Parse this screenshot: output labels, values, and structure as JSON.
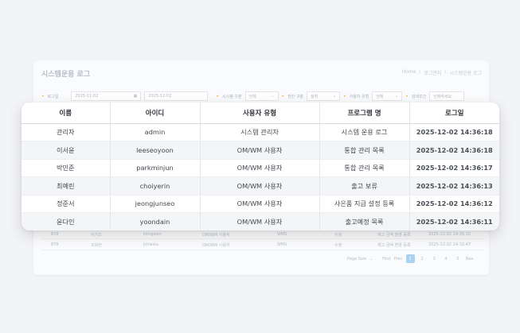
{
  "background": {
    "title": "시스템운용 로그",
    "breadcrumb": [
      "Home",
      "/",
      "로그관리",
      "/",
      "시스템운용 로그"
    ],
    "filters": {
      "date_label": "로그일",
      "date_from": "2025-11-02",
      "date_to": "2025-12-02",
      "system_type_label": "시스템 구분",
      "system_type_value": "전체",
      "auth_type_label": "권한 구분",
      "auth_type_value": "설력",
      "user_type_label": "사용자 유형",
      "user_type_value": "전체",
      "search_label": "검색조건",
      "search_value": "선택하세요"
    },
    "rows": [
      {
        "no": "878",
        "name": "서기즈",
        "id": "kimgsien",
        "type": "OM/WM 사용자",
        "sys": "WMS",
        "act": "수정",
        "prog": "재고 금액 변경 등록",
        "date": "2025-12-02 14:35:10"
      },
      {
        "no": "878",
        "name": "조화련",
        "id": "johwsla",
        "type": "OM/WM 사용자",
        "sys": "WMS",
        "act": "수정",
        "prog": "재고 금액 변경 등록",
        "date": "2025-12-02 14:32:47"
      }
    ],
    "pager": {
      "page_size_label": "Page Size",
      "first": "First",
      "prev": "Prev",
      "pages": [
        "1",
        "2",
        "3",
        "4",
        "5"
      ],
      "next": "Nex"
    }
  },
  "table": {
    "headers": [
      "이름",
      "아이디",
      "사용자 유형",
      "프로그램 명",
      "로그일"
    ],
    "rows": [
      [
        "관리자",
        "admin",
        "시스템 관리자",
        "시스템 운용 로그",
        "2025-12-02 14:36:18"
      ],
      [
        "이서윤",
        "leeseoyoon",
        "OM/WM 사용자",
        "통합 관리 목록",
        "2025-12-02 14:36:18"
      ],
      [
        "박민준",
        "parkminjun",
        "OM/WM 사용자",
        "통합 관리 목록",
        "2025-12-02 14:36:17"
      ],
      [
        "최예린",
        "choiyerin",
        "OM/WM 사용자",
        "출고 보류",
        "2025-12-02 14:36:13"
      ],
      [
        "정준서",
        "jeongjunseo",
        "OM/WM 사용자",
        "사은품 지급 설정 등록",
        "2025-12-02 14:36:12"
      ],
      [
        "윤다인",
        "yoondain",
        "OM/WM 사용자",
        "출고예정 목록",
        "2025-12-02 14:36:11"
      ]
    ]
  }
}
